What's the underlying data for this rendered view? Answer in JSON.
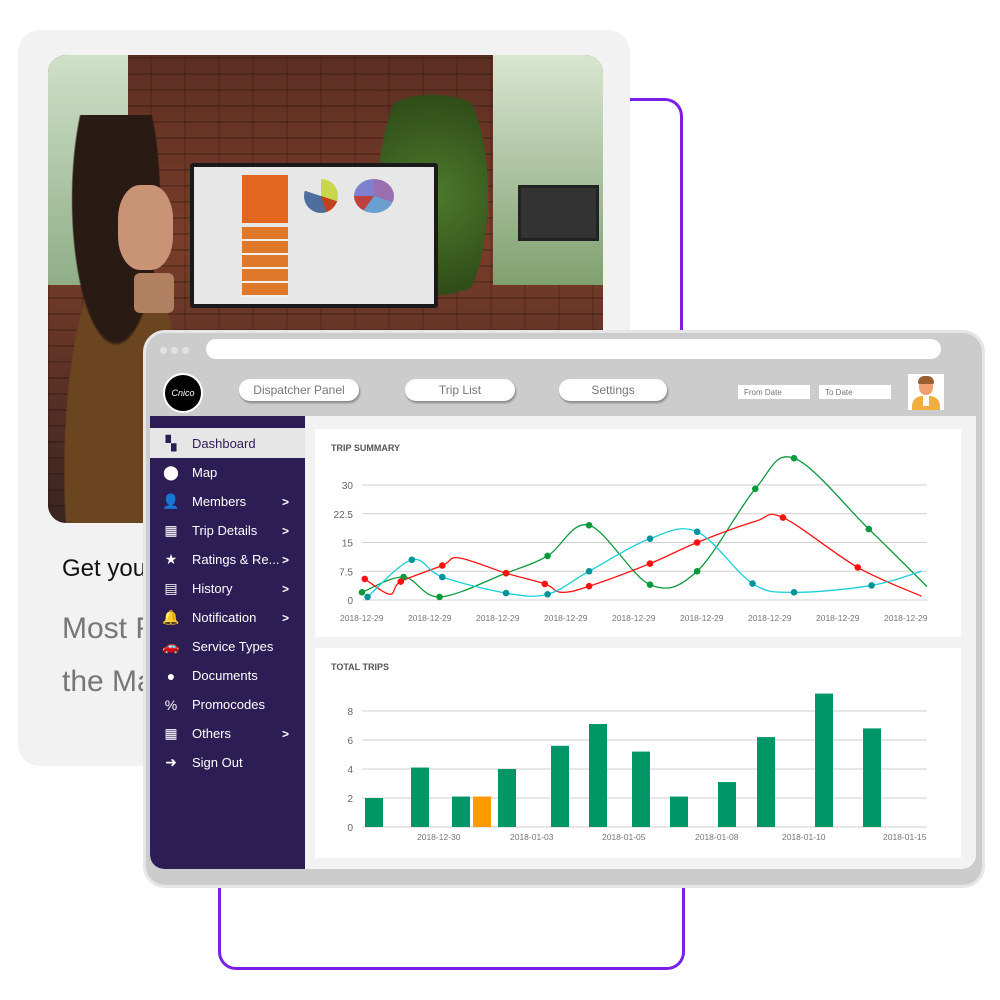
{
  "marketing": {
    "heading": "Get you",
    "sub_line1": "Most F",
    "sub_line2": "the Ma"
  },
  "browser": {
    "logo_text": "Cnico",
    "nav": [
      {
        "label": "Dispatcher Panel"
      },
      {
        "label": "Trip List"
      },
      {
        "label": "Settings"
      }
    ],
    "from_date_placeholder": "From Date",
    "to_date_placeholder": "To Date"
  },
  "sidebar": {
    "items": [
      {
        "label": "Dashboard",
        "icon": "dashboard-icon",
        "glyph": "▚",
        "active": true,
        "submenu": false
      },
      {
        "label": "Map",
        "icon": "map-pin-icon",
        "glyph": "⬤",
        "active": false,
        "submenu": false
      },
      {
        "label": "Members",
        "icon": "user-icon",
        "glyph": "👤",
        "active": false,
        "submenu": true
      },
      {
        "label": "Trip Details",
        "icon": "trip-details-icon",
        "glyph": "▦",
        "active": false,
        "submenu": true
      },
      {
        "label": "Ratings & Re...",
        "icon": "star-icon",
        "glyph": "★",
        "active": false,
        "submenu": true
      },
      {
        "label": "History",
        "icon": "history-icon",
        "glyph": "▤",
        "active": false,
        "submenu": true
      },
      {
        "label": "Notification",
        "icon": "bell-icon",
        "glyph": "🔔",
        "active": false,
        "submenu": true
      },
      {
        "label": "Service Types",
        "icon": "car-icon",
        "glyph": "🚗",
        "active": false,
        "submenu": false
      },
      {
        "label": "Documents",
        "icon": "documents-icon",
        "glyph": "●",
        "active": false,
        "submenu": false
      },
      {
        "label": "Promocodes",
        "icon": "promocode-icon",
        "glyph": "%",
        "active": false,
        "submenu": false
      },
      {
        "label": "Others",
        "icon": "grid-icon",
        "glyph": "▦",
        "active": false,
        "submenu": true
      },
      {
        "label": "Sign Out",
        "icon": "sign-out-icon",
        "glyph": "➜",
        "active": false,
        "submenu": false
      }
    ],
    "chevron": ">"
  },
  "chart_data": [
    {
      "type": "line",
      "title": "TRIP SUMMARY",
      "xlabel": "",
      "ylabel": "",
      "ylim": [
        0,
        30
      ],
      "yticks": [
        "0",
        "7.5",
        "15",
        "22.5",
        "30"
      ],
      "x_tick_labels": [
        "2018-12-29",
        "2018-12-29",
        "2018-12-29",
        "2018-12-29",
        "2018-12-29",
        "2018-12-29",
        "2018-12-29",
        "2018-12-29",
        "2018-12-29"
      ],
      "grid": true,
      "series": [
        {
          "name": "green",
          "color": "#0a9a3c",
          "points": [
            [
              0.0,
              2
            ],
            [
              0.75,
              6
            ],
            [
              1.4,
              0.8
            ],
            [
              2.6,
              7
            ],
            [
              3.35,
              11.5
            ],
            [
              4.1,
              19.5
            ],
            [
              5.2,
              4
            ],
            [
              6.05,
              7.5
            ],
            [
              7.1,
              29
            ],
            [
              7.8,
              37
            ],
            [
              9.15,
              18.5
            ],
            [
              10.2,
              3.5
            ]
          ]
        },
        {
          "name": "red",
          "color": "#ff1010",
          "points": [
            [
              0.05,
              5.5
            ],
            [
              0.5,
              1.5
            ],
            [
              0.7,
              4.8
            ],
            [
              1.45,
              9
            ],
            [
              1.75,
              11
            ],
            [
              2.6,
              7
            ],
            [
              3.3,
              4.2
            ],
            [
              3.6,
              2
            ],
            [
              4.1,
              3.6
            ],
            [
              5.2,
              9.5
            ],
            [
              6.05,
              15
            ],
            [
              7.1,
              20.5
            ],
            [
              7.6,
              21.5
            ],
            [
              8.95,
              8.5
            ],
            [
              10.1,
              1
            ]
          ]
        },
        {
          "name": "cyan",
          "color": "#1ccfd8",
          "points": [
            [
              0.1,
              0.8
            ],
            [
              0.9,
              10.5
            ],
            [
              1.45,
              6
            ],
            [
              2.6,
              1.8
            ],
            [
              3.35,
              1.5
            ],
            [
              4.1,
              7.5
            ],
            [
              5.2,
              16
            ],
            [
              6.05,
              17.8
            ],
            [
              7.05,
              4.3
            ],
            [
              7.8,
              2
            ],
            [
              9.2,
              3.8
            ],
            [
              10.1,
              7.5
            ]
          ],
          "marker_color": "#009399"
        }
      ]
    },
    {
      "type": "bar",
      "title": "TOTAL TRIPS",
      "xlabel": "",
      "ylabel": "",
      "ylim": [
        0,
        9
      ],
      "yticks": [
        "0",
        "2",
        "4",
        "6",
        "8"
      ],
      "x_tick_labels": [
        "2018-12-30",
        "2018-01-03",
        "2018-01-05",
        "2018-01-08",
        "2018-01-10",
        "2018-01-15"
      ],
      "grid": true,
      "bars": [
        {
          "value": 2.0,
          "color": "#009665"
        },
        {
          "value": 4.1,
          "color": "#009665"
        },
        {
          "value": 2.1,
          "color": "#009665"
        },
        {
          "value": 2.1,
          "color": "#ff9900"
        },
        {
          "value": 4.0,
          "color": "#009665"
        },
        {
          "value": 5.6,
          "color": "#009665"
        },
        {
          "value": 7.1,
          "color": "#009665"
        },
        {
          "value": 5.2,
          "color": "#009665"
        },
        {
          "value": 2.1,
          "color": "#009665"
        },
        {
          "value": 3.1,
          "color": "#009665"
        },
        {
          "value": 6.2,
          "color": "#009665"
        },
        {
          "value": 9.2,
          "color": "#009665"
        },
        {
          "value": 6.8,
          "color": "#009665"
        }
      ]
    }
  ]
}
